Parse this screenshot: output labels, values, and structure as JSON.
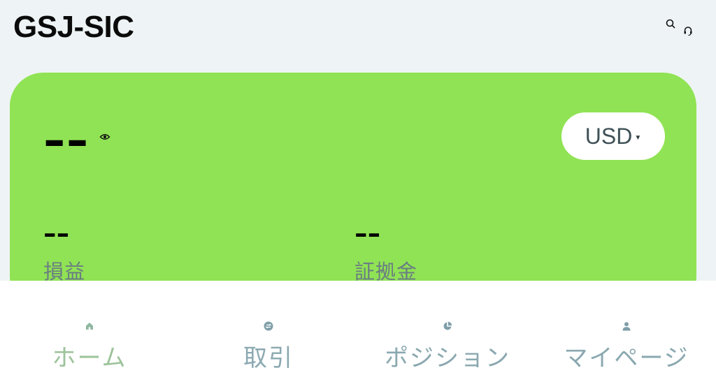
{
  "header": {
    "brand": "GSJ-SIC",
    "icons": [
      "search-icon",
      "headset-icon"
    ]
  },
  "card": {
    "balance": "--",
    "currency": "USD",
    "stats": [
      {
        "value": "--",
        "label": "損益"
      },
      {
        "value": "--",
        "label": "証拠金"
      }
    ],
    "background": "#90e354"
  },
  "nav": {
    "items": [
      {
        "label": "ホーム",
        "icon": "home-icon",
        "active": true
      },
      {
        "label": "取引",
        "icon": "exchange-icon",
        "active": false
      },
      {
        "label": "ポジション",
        "icon": "pie-chart-icon",
        "active": false
      },
      {
        "label": "マイページ",
        "icon": "user-icon",
        "active": false
      }
    ],
    "active_color": "#9cc39a",
    "inactive_color": "#8aa8b0"
  }
}
